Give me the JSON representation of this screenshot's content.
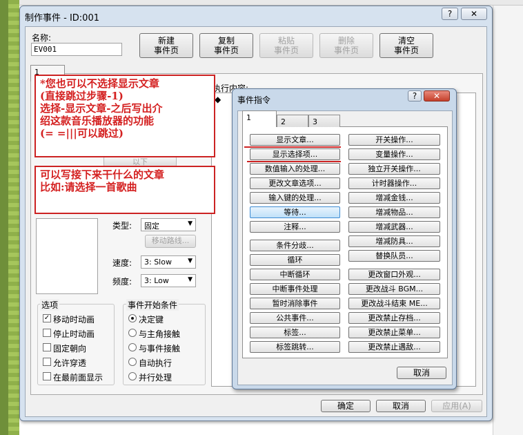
{
  "window": {
    "title": "制作事件 - ID:001",
    "help_btn": "?",
    "close_btn": "✕"
  },
  "name_label": "名称:",
  "name_value": "EV001",
  "page_buttons": [
    {
      "line1": "新建",
      "line2": "事件页",
      "enabled": true
    },
    {
      "line1": "复制",
      "line2": "事件页",
      "enabled": true
    },
    {
      "line1": "粘贴",
      "line2": "事件页",
      "enabled": false
    },
    {
      "line1": "删除",
      "line2": "事件页",
      "enabled": false
    },
    {
      "line1": "清空",
      "line2": "事件页",
      "enabled": true
    }
  ],
  "event_page_tab": "1",
  "content_label": "执行内容:",
  "content_bullet": "◆",
  "hidden_button_fragment": "以下",
  "notes": {
    "note1": [
      "*您也可以不选择显示文章",
      "(直接跳过步骤-1)",
      "选择-显示文章-之后写出介",
      "绍这款音乐播放器的功能",
      "(= =|||可以跳过)"
    ],
    "note2": [
      "可以写接下来干什么的文章",
      "比如:请选择一首歌曲"
    ]
  },
  "movement": {
    "type_label": "类型:",
    "type_value": "固定",
    "route_button": "移动路线...",
    "speed_label": "速度:",
    "speed_value": "3: Slow",
    "freq_label": "频度:",
    "freq_value": "3: Low"
  },
  "options": {
    "title": "选项",
    "items": [
      {
        "label": "移动时动画",
        "checked": true
      },
      {
        "label": "停止时动画",
        "checked": false
      },
      {
        "label": "固定朝向",
        "checked": false
      },
      {
        "label": "允许穿透",
        "checked": false
      },
      {
        "label": "在最前面显示",
        "checked": false
      }
    ]
  },
  "trigger": {
    "title": "事件开始条件",
    "items": [
      {
        "label": "决定键",
        "selected": true
      },
      {
        "label": "与主角接触",
        "selected": false
      },
      {
        "label": "与事件接触",
        "selected": false
      },
      {
        "label": "自动执行",
        "selected": false
      },
      {
        "label": "并行处理",
        "selected": false
      }
    ]
  },
  "footer": {
    "ok": "确定",
    "cancel": "取消",
    "apply": "应用(A)"
  },
  "dialog": {
    "title": "事件指令",
    "help_btn": "?",
    "close_btn": "✕",
    "tabs": [
      "1",
      "2",
      "3"
    ],
    "left_commands": [
      "显示文章...",
      "显示选择项...",
      "数值输入的处理...",
      "更改文章选项...",
      "输入键的处理...",
      "等待...",
      "注释...",
      "条件分歧...",
      "循环",
      "中断循环",
      "中断事件处理",
      "暂时消除事件",
      "公共事件...",
      "标签...",
      "标签跳转..."
    ],
    "right_commands": [
      "开关操作...",
      "变量操作...",
      "独立开关操作...",
      "计时器操作...",
      "增减金钱...",
      "增减物品...",
      "增减武器...",
      "增减防具...",
      "替换队员...",
      "更改窗口外观...",
      "更改战斗 BGM...",
      "更改战斗结束 ME...",
      "更改禁止存档...",
      "更改禁止菜单...",
      "更改禁止遇敌..."
    ],
    "cancel": "取消"
  }
}
